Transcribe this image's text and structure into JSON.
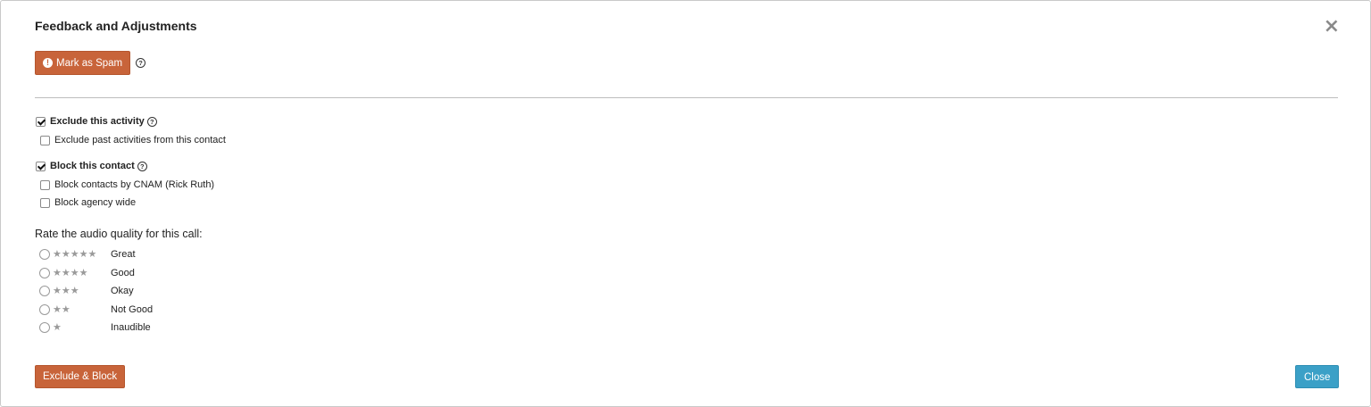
{
  "dialog": {
    "title": "Feedback and Adjustments",
    "close_icon": "×"
  },
  "spam": {
    "label": "Mark as Spam",
    "icon": "alert-icon",
    "help_glyph": "?"
  },
  "options": {
    "exclude_activity": {
      "label": "Exclude this activity",
      "checked": true
    },
    "exclude_past": {
      "label": "Exclude past activities from this contact",
      "checked": false
    },
    "block_contact": {
      "label": "Block this contact",
      "checked": true
    },
    "block_cnam": {
      "label": "Block contacts by CNAM (Rick Ruth)",
      "checked": false
    },
    "block_agency": {
      "label": "Block agency wide",
      "checked": false
    }
  },
  "rating": {
    "label": "Rate the audio quality for this call:",
    "items": [
      {
        "stars": "★★★★★",
        "label": "Great"
      },
      {
        "stars": "★★★★",
        "label": "Good"
      },
      {
        "stars": "★★★",
        "label": "Okay"
      },
      {
        "stars": "★★",
        "label": "Not Good"
      },
      {
        "stars": "★",
        "label": "Inaudible"
      }
    ]
  },
  "footer": {
    "exclude_block_label": "Exclude & Block",
    "close_label": "Close"
  },
  "colors": {
    "primary_orange": "#c8643a",
    "close_blue": "#3ba0c7"
  }
}
